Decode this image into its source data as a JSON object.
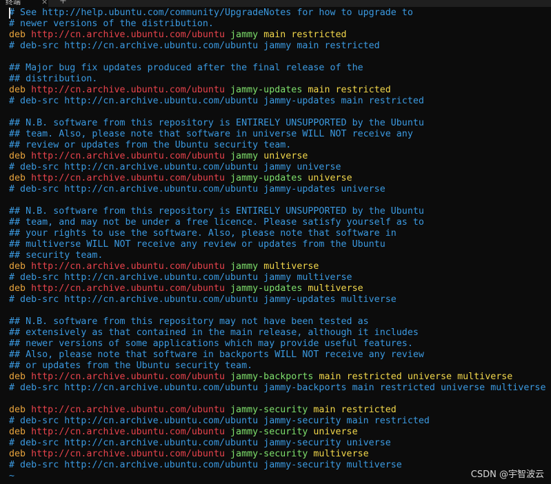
{
  "window": {
    "tab_label": "终端",
    "close_glyph": "×",
    "new_tab_glyph": "+"
  },
  "colors": {
    "comment": "#3b9ae1",
    "keyword": "#e8a33c",
    "url": "#e8434c",
    "dist": "#7ee06c",
    "component": "#f2d74b",
    "tilde": "#3b9ae1",
    "background": "#0c0c0c"
  },
  "file_lines": [
    [
      {
        "t": "# See http://help.ubuntu.com/community/UpgradeNotes for how to upgrade to",
        "c": "comment"
      }
    ],
    [
      {
        "t": "# newer versions of the distribution.",
        "c": "comment"
      }
    ],
    [
      {
        "t": "deb ",
        "c": "keyword"
      },
      {
        "t": "http://cn.archive.ubuntu.com/ubuntu",
        "c": "url"
      },
      {
        "t": " jammy ",
        "c": "dist"
      },
      {
        "t": "main restricted",
        "c": "component"
      }
    ],
    [
      {
        "t": "# deb-src http://cn.archive.ubuntu.com/ubuntu jammy main restricted",
        "c": "comment"
      }
    ],
    [],
    [
      {
        "t": "## Major bug fix updates produced after the final release of the",
        "c": "comment"
      }
    ],
    [
      {
        "t": "## distribution.",
        "c": "comment"
      }
    ],
    [
      {
        "t": "deb ",
        "c": "keyword"
      },
      {
        "t": "http://cn.archive.ubuntu.com/ubuntu",
        "c": "url"
      },
      {
        "t": " jammy-updates ",
        "c": "dist"
      },
      {
        "t": "main restricted",
        "c": "component"
      }
    ],
    [
      {
        "t": "# deb-src http://cn.archive.ubuntu.com/ubuntu jammy-updates main restricted",
        "c": "comment"
      }
    ],
    [],
    [
      {
        "t": "## N.B. software from this repository is ENTIRELY UNSUPPORTED by the Ubuntu",
        "c": "comment"
      }
    ],
    [
      {
        "t": "## team. Also, please note that software in universe WILL NOT receive any",
        "c": "comment"
      }
    ],
    [
      {
        "t": "## review or updates from the Ubuntu security team.",
        "c": "comment"
      }
    ],
    [
      {
        "t": "deb ",
        "c": "keyword"
      },
      {
        "t": "http://cn.archive.ubuntu.com/ubuntu",
        "c": "url"
      },
      {
        "t": " jammy ",
        "c": "dist"
      },
      {
        "t": "universe",
        "c": "component"
      }
    ],
    [
      {
        "t": "# deb-src http://cn.archive.ubuntu.com/ubuntu jammy universe",
        "c": "comment"
      }
    ],
    [
      {
        "t": "deb ",
        "c": "keyword"
      },
      {
        "t": "http://cn.archive.ubuntu.com/ubuntu",
        "c": "url"
      },
      {
        "t": " jammy-updates ",
        "c": "dist"
      },
      {
        "t": "universe",
        "c": "component"
      }
    ],
    [
      {
        "t": "# deb-src http://cn.archive.ubuntu.com/ubuntu jammy-updates universe",
        "c": "comment"
      }
    ],
    [],
    [
      {
        "t": "## N.B. software from this repository is ENTIRELY UNSUPPORTED by the Ubuntu",
        "c": "comment"
      }
    ],
    [
      {
        "t": "## team, and may not be under a free licence. Please satisfy yourself as to",
        "c": "comment"
      }
    ],
    [
      {
        "t": "## your rights to use the software. Also, please note that software in",
        "c": "comment"
      }
    ],
    [
      {
        "t": "## multiverse WILL NOT receive any review or updates from the Ubuntu",
        "c": "comment"
      }
    ],
    [
      {
        "t": "## security team.",
        "c": "comment"
      }
    ],
    [
      {
        "t": "deb ",
        "c": "keyword"
      },
      {
        "t": "http://cn.archive.ubuntu.com/ubuntu",
        "c": "url"
      },
      {
        "t": " jammy ",
        "c": "dist"
      },
      {
        "t": "multiverse",
        "c": "component"
      }
    ],
    [
      {
        "t": "# deb-src http://cn.archive.ubuntu.com/ubuntu jammy multiverse",
        "c": "comment"
      }
    ],
    [
      {
        "t": "deb ",
        "c": "keyword"
      },
      {
        "t": "http://cn.archive.ubuntu.com/ubuntu",
        "c": "url"
      },
      {
        "t": " jammy-updates ",
        "c": "dist"
      },
      {
        "t": "multiverse",
        "c": "component"
      }
    ],
    [
      {
        "t": "# deb-src http://cn.archive.ubuntu.com/ubuntu jammy-updates multiverse",
        "c": "comment"
      }
    ],
    [],
    [
      {
        "t": "## N.B. software from this repository may not have been tested as",
        "c": "comment"
      }
    ],
    [
      {
        "t": "## extensively as that contained in the main release, although it includes",
        "c": "comment"
      }
    ],
    [
      {
        "t": "## newer versions of some applications which may provide useful features.",
        "c": "comment"
      }
    ],
    [
      {
        "t": "## Also, please note that software in backports WILL NOT receive any review",
        "c": "comment"
      }
    ],
    [
      {
        "t": "## or updates from the Ubuntu security team.",
        "c": "comment"
      }
    ],
    [
      {
        "t": "deb ",
        "c": "keyword"
      },
      {
        "t": "http://cn.archive.ubuntu.com/ubuntu",
        "c": "url"
      },
      {
        "t": " jammy-backports ",
        "c": "dist"
      },
      {
        "t": "main restricted universe multiverse",
        "c": "component"
      }
    ],
    [
      {
        "t": "# deb-src http://cn.archive.ubuntu.com/ubuntu jammy-backports main restricted universe multiverse",
        "c": "comment"
      }
    ],
    [],
    [
      {
        "t": "deb ",
        "c": "keyword"
      },
      {
        "t": "http://cn.archive.ubuntu.com/ubuntu",
        "c": "url"
      },
      {
        "t": " jammy-security ",
        "c": "dist"
      },
      {
        "t": "main restricted",
        "c": "component"
      }
    ],
    [
      {
        "t": "# deb-src http://cn.archive.ubuntu.com/ubuntu jammy-security main restricted",
        "c": "comment"
      }
    ],
    [
      {
        "t": "deb ",
        "c": "keyword"
      },
      {
        "t": "http://cn.archive.ubuntu.com/ubuntu",
        "c": "url"
      },
      {
        "t": " jammy-security ",
        "c": "dist"
      },
      {
        "t": "universe",
        "c": "component"
      }
    ],
    [
      {
        "t": "# deb-src http://cn.archive.ubuntu.com/ubuntu jammy-security universe",
        "c": "comment"
      }
    ],
    [
      {
        "t": "deb ",
        "c": "keyword"
      },
      {
        "t": "http://cn.archive.ubuntu.com/ubuntu",
        "c": "url"
      },
      {
        "t": " jammy-security ",
        "c": "dist"
      },
      {
        "t": "multiverse",
        "c": "component"
      }
    ],
    [
      {
        "t": "# deb-src http://cn.archive.ubuntu.com/ubuntu jammy-security multiverse",
        "c": "comment"
      }
    ]
  ],
  "empty_line_marker": "~",
  "watermark": "CSDN @宇智波云"
}
